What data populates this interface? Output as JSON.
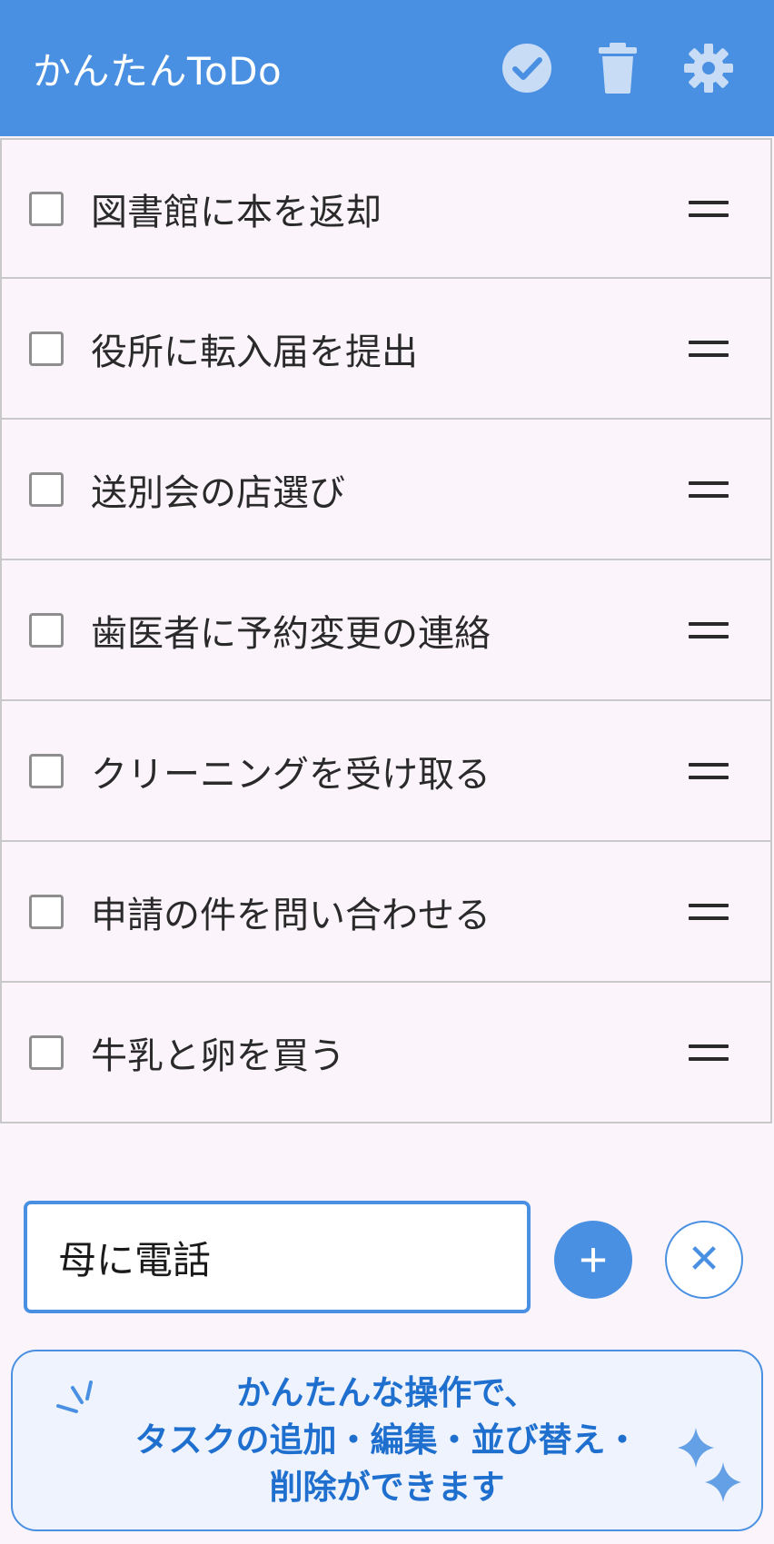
{
  "app": {
    "title": "かんたんToDo"
  },
  "header": {
    "icons": [
      "check-circle-icon",
      "trash-icon",
      "gear-icon"
    ]
  },
  "tasks": [
    {
      "label": "図書館に本を返却",
      "checked": false
    },
    {
      "label": "役所に転入届を提出",
      "checked": false
    },
    {
      "label": "送別会の店選び",
      "checked": false
    },
    {
      "label": "歯医者に予約変更の連絡",
      "checked": false
    },
    {
      "label": "クリーニングを受け取る",
      "checked": false
    },
    {
      "label": "申請の件を問い合わせる",
      "checked": false
    },
    {
      "label": "牛乳と卵を買う",
      "checked": false
    }
  ],
  "input": {
    "value": "母に電話"
  },
  "buttons": {
    "add_symbol": "+",
    "clear_symbol": "✕"
  },
  "banner": {
    "lines": [
      "かんたんな操作で、",
      "タスクの追加・編集・並び替え・",
      "削除ができます"
    ]
  },
  "colors": {
    "accent": "#4a90e2",
    "background": "#fbf5fb",
    "banner_text": "#1f6fcf"
  }
}
